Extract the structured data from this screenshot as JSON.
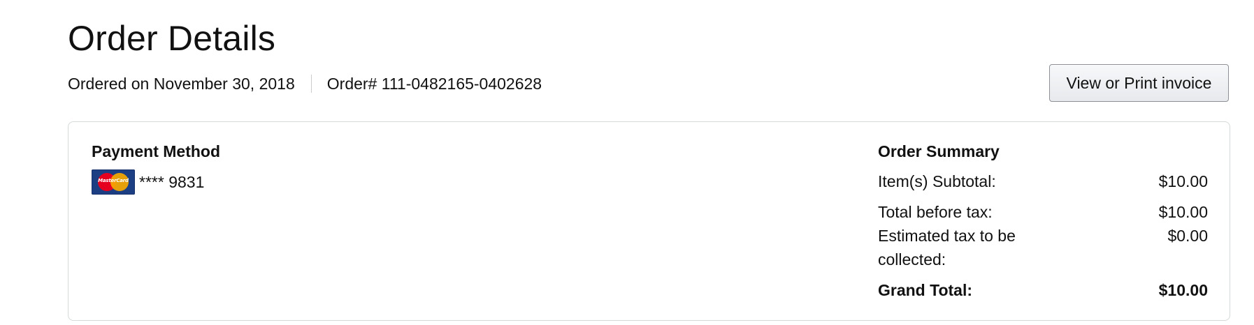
{
  "page": {
    "title": "Order Details"
  },
  "order_meta": {
    "ordered_on": "Ordered on November 30, 2018",
    "order_number": "Order# 111-0482165-0402628"
  },
  "invoice_button": {
    "label": "View or Print invoice"
  },
  "payment": {
    "heading": "Payment Method",
    "card_icon": "mastercard-icon",
    "card_logo_text": "MasterCard",
    "card_number": "**** 9831"
  },
  "summary": {
    "heading": "Order Summary",
    "rows": [
      {
        "label": "Item(s) Subtotal:",
        "value": "$10.00"
      },
      {
        "label": "Total before tax:",
        "value": "$10.00"
      },
      {
        "label": "Estimated tax to be collected:",
        "value": "$0.00"
      }
    ],
    "grand_total": {
      "label": "Grand Total:",
      "value": "$10.00"
    }
  },
  "colors": {
    "button_border": "#8d9096",
    "box_border": "#d5d9d9",
    "text": "#111111"
  }
}
